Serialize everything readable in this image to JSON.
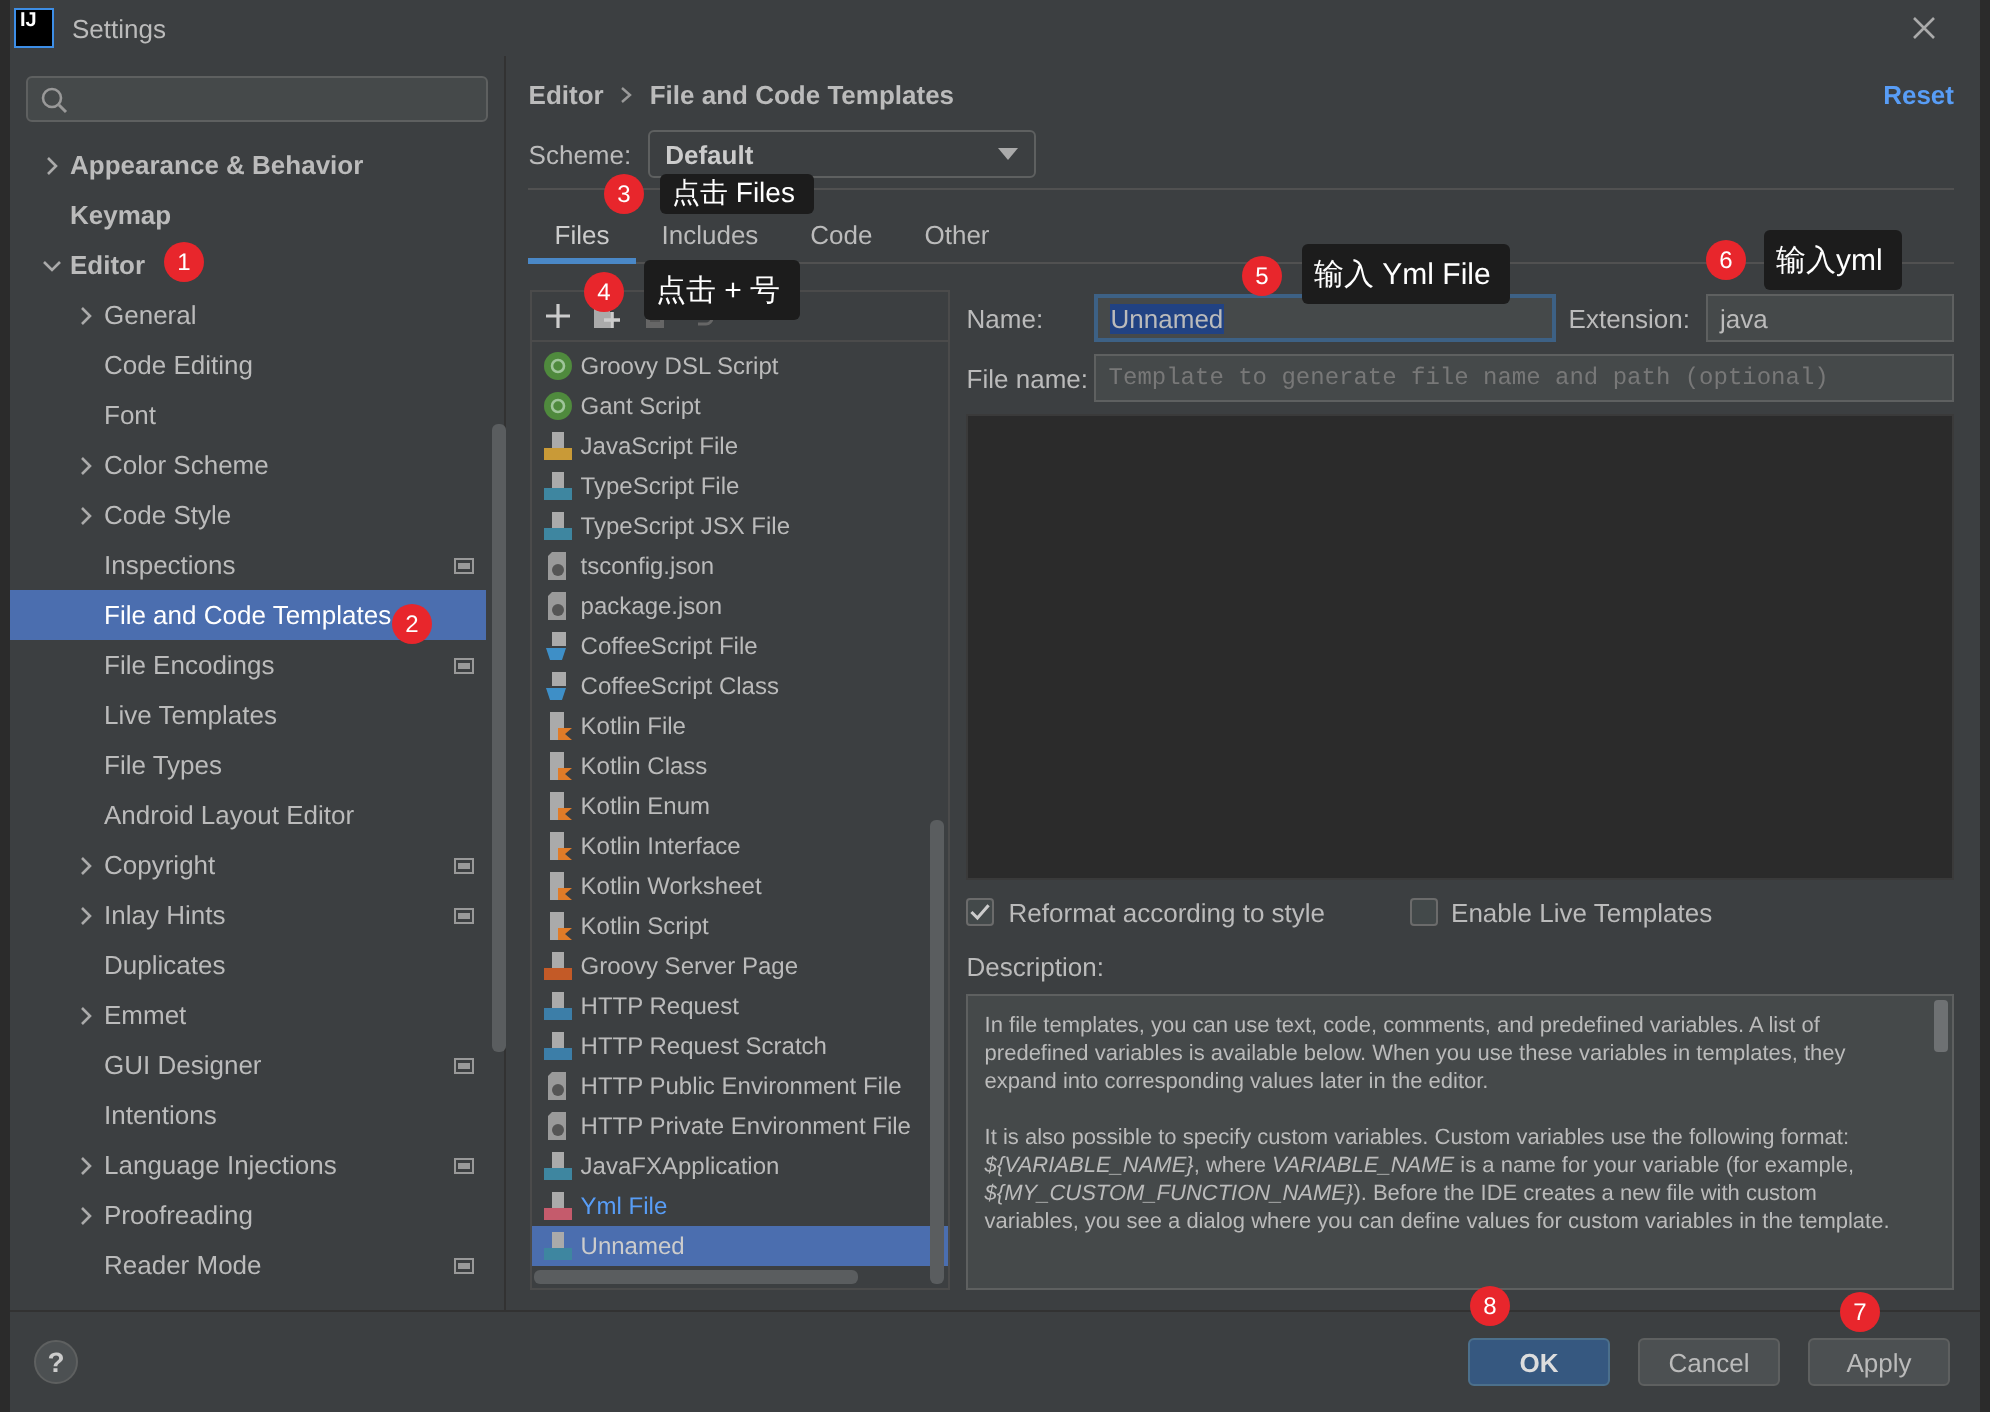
{
  "window": {
    "icon_text": "IJ",
    "title": "Settings"
  },
  "sidebar": {
    "items": [
      {
        "label": "Appearance & Behavior",
        "kind": "group",
        "expanded": false,
        "selected": false,
        "project_scope": false
      },
      {
        "label": "Keymap",
        "kind": "page",
        "selected": false,
        "project_scope": false
      },
      {
        "label": "Editor",
        "kind": "group",
        "expanded": true,
        "selected": false,
        "project_scope": false,
        "children": [
          {
            "label": "General",
            "kind": "group",
            "expanded": false,
            "selected": false,
            "project_scope": false
          },
          {
            "label": "Code Editing",
            "kind": "page",
            "selected": false,
            "project_scope": false
          },
          {
            "label": "Font",
            "kind": "page",
            "selected": false,
            "project_scope": false
          },
          {
            "label": "Color Scheme",
            "kind": "group",
            "expanded": false,
            "selected": false,
            "project_scope": false
          },
          {
            "label": "Code Style",
            "kind": "group",
            "expanded": false,
            "selected": false,
            "project_scope": false
          },
          {
            "label": "Inspections",
            "kind": "page",
            "selected": false,
            "project_scope": true
          },
          {
            "label": "File and Code Templates",
            "kind": "page",
            "selected": true,
            "project_scope": false
          },
          {
            "label": "File Encodings",
            "kind": "page",
            "selected": false,
            "project_scope": true
          },
          {
            "label": "Live Templates",
            "kind": "page",
            "selected": false,
            "project_scope": false
          },
          {
            "label": "File Types",
            "kind": "page",
            "selected": false,
            "project_scope": false
          },
          {
            "label": "Android Layout Editor",
            "kind": "page",
            "selected": false,
            "project_scope": false
          },
          {
            "label": "Copyright",
            "kind": "group",
            "expanded": false,
            "selected": false,
            "project_scope": true
          },
          {
            "label": "Inlay Hints",
            "kind": "group",
            "expanded": false,
            "selected": false,
            "project_scope": true
          },
          {
            "label": "Duplicates",
            "kind": "page",
            "selected": false,
            "project_scope": false
          },
          {
            "label": "Emmet",
            "kind": "group",
            "expanded": false,
            "selected": false,
            "project_scope": false
          },
          {
            "label": "GUI Designer",
            "kind": "page",
            "selected": false,
            "project_scope": true
          },
          {
            "label": "Intentions",
            "kind": "page",
            "selected": false,
            "project_scope": false
          },
          {
            "label": "Language Injections",
            "kind": "group",
            "expanded": false,
            "selected": false,
            "project_scope": true
          },
          {
            "label": "Proofreading",
            "kind": "group",
            "expanded": false,
            "selected": false,
            "project_scope": false
          },
          {
            "label": "Reader Mode",
            "kind": "page",
            "selected": false,
            "project_scope": true
          }
        ]
      }
    ]
  },
  "breadcrumb": [
    "Editor",
    "File and Code Templates"
  ],
  "reset": "Reset",
  "scheme": {
    "label": "Scheme:",
    "value": "Default"
  },
  "tabs": [
    {
      "label": "Files",
      "selected": true
    },
    {
      "label": "Includes",
      "selected": false
    },
    {
      "label": "Code",
      "selected": false
    },
    {
      "label": "Other",
      "selected": false
    }
  ],
  "templates": [
    {
      "name": "Groovy DSL Script",
      "kind": "groovy",
      "customized": false,
      "selected": false
    },
    {
      "name": "Gant Script",
      "kind": "groovy",
      "customized": false,
      "selected": false
    },
    {
      "name": "JavaScript File",
      "kind": "js",
      "customized": false,
      "selected": false
    },
    {
      "name": "TypeScript File",
      "kind": "ts",
      "customized": false,
      "selected": false
    },
    {
      "name": "TypeScript JSX File",
      "kind": "ts",
      "customized": false,
      "selected": false
    },
    {
      "name": "tsconfig.json",
      "kind": "config",
      "customized": false,
      "selected": false
    },
    {
      "name": "package.json",
      "kind": "config",
      "customized": false,
      "selected": false
    },
    {
      "name": "CoffeeScript File",
      "kind": "coffee",
      "customized": false,
      "selected": false
    },
    {
      "name": "CoffeeScript Class",
      "kind": "coffee",
      "customized": false,
      "selected": false
    },
    {
      "name": "Kotlin File",
      "kind": "kotlin",
      "customized": false,
      "selected": false
    },
    {
      "name": "Kotlin Class",
      "kind": "kotlin",
      "customized": false,
      "selected": false
    },
    {
      "name": "Kotlin Enum",
      "kind": "kotlin",
      "customized": false,
      "selected": false
    },
    {
      "name": "Kotlin Interface",
      "kind": "kotlin",
      "customized": false,
      "selected": false
    },
    {
      "name": "Kotlin Worksheet",
      "kind": "kotlin",
      "customized": false,
      "selected": false
    },
    {
      "name": "Kotlin Script",
      "kind": "kotlin",
      "customized": false,
      "selected": false
    },
    {
      "name": "Groovy Server Page",
      "kind": "gsp",
      "customized": false,
      "selected": false
    },
    {
      "name": "HTTP Request",
      "kind": "api",
      "customized": false,
      "selected": false
    },
    {
      "name": "HTTP Request Scratch",
      "kind": "api",
      "customized": false,
      "selected": false
    },
    {
      "name": "HTTP Public Environment File",
      "kind": "config",
      "customized": false,
      "selected": false
    },
    {
      "name": "HTTP Private Environment File",
      "kind": "config",
      "customized": false,
      "selected": false
    },
    {
      "name": "JavaFXApplication",
      "kind": "java",
      "customized": false,
      "selected": false
    },
    {
      "name": "Yml File",
      "kind": "yml",
      "customized": true,
      "selected": false
    },
    {
      "name": "Unnamed",
      "kind": "java",
      "customized": false,
      "selected": true
    }
  ],
  "editor": {
    "name_label": "Name:",
    "name_value": "Unnamed",
    "name_text_selected": true,
    "extension_label": "Extension:",
    "extension_value": "java",
    "file_name_label": "File name:",
    "file_name_placeholder": "Template to generate file name and path (optional)"
  },
  "options": [
    {
      "label": "Reformat according to style",
      "checked": true
    },
    {
      "label": "Enable Live Templates",
      "checked": false
    }
  ],
  "description": {
    "label": "Description:",
    "paragraphs": [
      "In file templates, you can use text, code, comments, and predefined variables. A list of predefined variables is available below. When you use these variables in templates, they expand into corresponding values later in the editor.",
      "It is also possible to specify custom variables. Custom variables use the following format: *${VARIABLE_NAME}*, where *VARIABLE_NAME* is a name for your variable (for example, *${MY_CUSTOM_FUNCTION_NAME}*). Before the IDE creates a new file with custom variables, you see a dialog where you can define values for custom variables in the template."
    ]
  },
  "help": "?",
  "buttons": [
    {
      "label": "OK",
      "kind": "default"
    },
    {
      "label": "Cancel",
      "kind": "normal"
    },
    {
      "label": "Apply",
      "kind": "normal"
    }
  ],
  "annotations": [
    {
      "number": "1"
    },
    {
      "number": "2"
    },
    {
      "number": "3",
      "label": "点击 Files"
    },
    {
      "number": "4",
      "label": "点击 + 号"
    },
    {
      "number": "5",
      "label": "输入 Yml File"
    },
    {
      "number": "6",
      "label": "输入yml"
    },
    {
      "number": "7"
    },
    {
      "number": "8"
    }
  ]
}
